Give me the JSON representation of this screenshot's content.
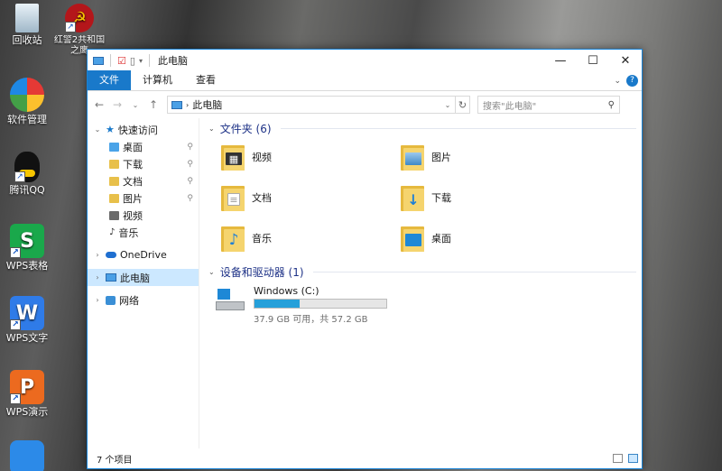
{
  "desktop": {
    "icons": [
      {
        "label": "回收站",
        "icon": "recycle-bin-icon"
      },
      {
        "label": "红警2共和国之鹰",
        "icon": "red-alert-icon"
      },
      {
        "label": "软件管理",
        "icon": "software-manager-icon"
      },
      {
        "label": "腾讯QQ",
        "icon": "qq-icon"
      },
      {
        "label": "WPS表格",
        "icon": "wps-spreadsheet-icon"
      },
      {
        "label": "WPS文字",
        "icon": "wps-writer-icon"
      },
      {
        "label": "WPS演示",
        "icon": "wps-presentation-icon"
      }
    ]
  },
  "window": {
    "title": "此电脑",
    "controls": {
      "minimize": "—",
      "maximize": "☐",
      "close": "✕"
    },
    "ribbon_tabs": [
      "文件",
      "计算机",
      "查看"
    ],
    "help": "?",
    "address": {
      "path": "此电脑",
      "search_placeholder": "搜索\"此电脑\""
    },
    "nav": {
      "quick_access": "快速访问",
      "quick_items": [
        "桌面",
        "下载",
        "文档",
        "图片",
        "视频",
        "音乐"
      ],
      "onedrive": "OneDrive",
      "this_pc": "此电脑",
      "network": "网络"
    },
    "folders_group": {
      "header": "文件夹 (6)",
      "items": [
        {
          "name": "视频",
          "icon": "video-folder-icon"
        },
        {
          "name": "图片",
          "icon": "pictures-folder-icon"
        },
        {
          "name": "文档",
          "icon": "documents-folder-icon"
        },
        {
          "name": "下载",
          "icon": "downloads-folder-icon"
        },
        {
          "name": "音乐",
          "icon": "music-folder-icon"
        },
        {
          "name": "桌面",
          "icon": "desktop-folder-icon"
        }
      ]
    },
    "devices_group": {
      "header": "设备和驱动器 (1)",
      "drive": {
        "name": "Windows (C:)",
        "size_text": "37.9 GB 可用，共 57.2 GB",
        "used_fraction": 0.34
      }
    },
    "status": "7 个项目"
  },
  "colors": {
    "accent": "#1979ca",
    "drive_bar": "#26a0da",
    "group_header": "#1e3287",
    "selection": "#cce8ff"
  }
}
